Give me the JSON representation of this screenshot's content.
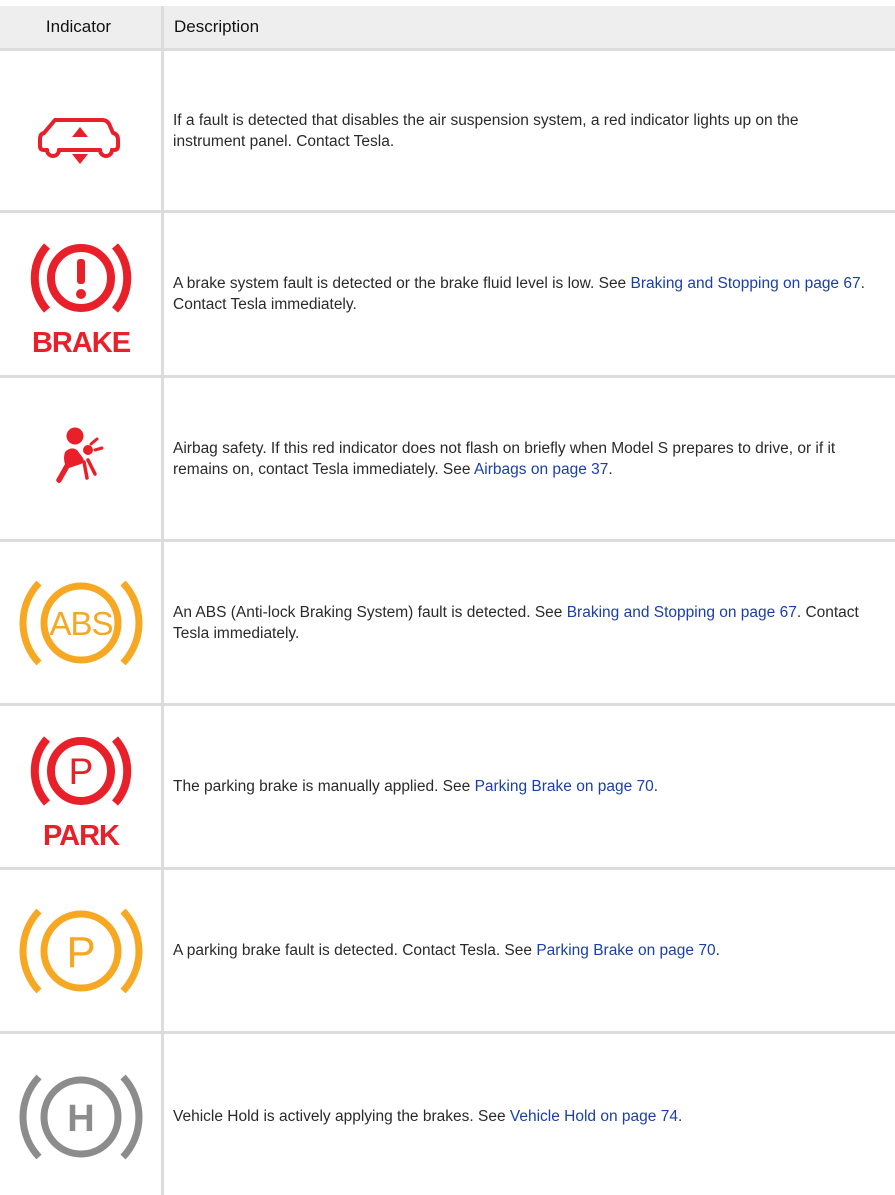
{
  "header": {
    "indicator_label": "Indicator",
    "description_label": "Description"
  },
  "rows": [
    {
      "icon": "air-suspension-fault-icon",
      "color": "#e8202a",
      "parts": [
        "If a fault is detected that disables the air suspension system, a red indicator lights up on the instrument panel. Contact Tesla."
      ]
    },
    {
      "icon": "brake-warning-icon",
      "color": "#e8202a",
      "icon_text": "BRAKE",
      "parts": [
        "A brake system fault is detected or the brake fluid level is low. See ",
        "Braking and Stopping on page 67",
        ". Contact Tesla immediately."
      ]
    },
    {
      "icon": "airbag-icon",
      "color": "#e8202a",
      "parts": [
        "Airbag safety. If this red indicator does not flash on briefly when Model S prepares to drive, or if it remains on, contact Tesla immediately. See ",
        "Airbags on page 37",
        "."
      ]
    },
    {
      "icon": "abs-fault-icon",
      "color": "#f7a823",
      "icon_text": "ABS",
      "parts": [
        "An ABS (Anti-lock Braking System) fault is detected. See ",
        "Braking and Stopping on page 67",
        ". Contact Tesla immediately."
      ]
    },
    {
      "icon": "park-brake-icon",
      "color": "#e8202a",
      "icon_text": "P",
      "icon_subtext": "PARK",
      "parts": [
        "The parking brake is manually applied. See ",
        "Parking Brake on page 70",
        "."
      ]
    },
    {
      "icon": "park-brake-fault-icon",
      "color": "#f7a823",
      "icon_text": "P",
      "parts": [
        "A parking brake fault is detected. Contact Tesla. See ",
        "Parking Brake on page 70",
        "."
      ]
    },
    {
      "icon": "vehicle-hold-icon",
      "color": "#8c8c8c",
      "icon_text": "H",
      "parts": [
        "Vehicle Hold is actively applying the brakes. See ",
        "Vehicle Hold on page 74",
        "."
      ]
    }
  ]
}
